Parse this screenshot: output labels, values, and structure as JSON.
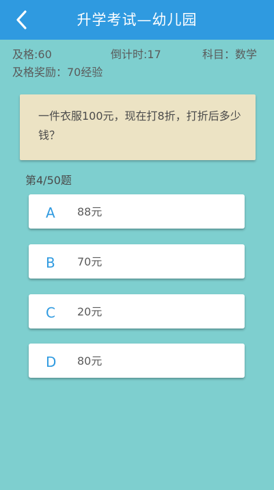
{
  "header": {
    "title": "升学考试—幼儿园",
    "back_icon": "chevron-left-icon"
  },
  "info": {
    "pass_score": "及格:60",
    "countdown": "倒计时:17",
    "subject": "科目：数学",
    "pass_reward": "及格奖励：70经验"
  },
  "question": {
    "text": "一件衣服100元，现在打8折，打折后多少钱？",
    "progress": "第4/50题"
  },
  "options": [
    {
      "letter": "A",
      "text": "88元"
    },
    {
      "letter": "B",
      "text": "70元"
    },
    {
      "letter": "C",
      "text": "20元"
    },
    {
      "letter": "D",
      "text": "80元"
    }
  ],
  "colors": {
    "background": "#7ecfcf",
    "header": "#2f9ae0",
    "question_card": "#ece3c4",
    "option_letter": "#2f9ae0"
  }
}
